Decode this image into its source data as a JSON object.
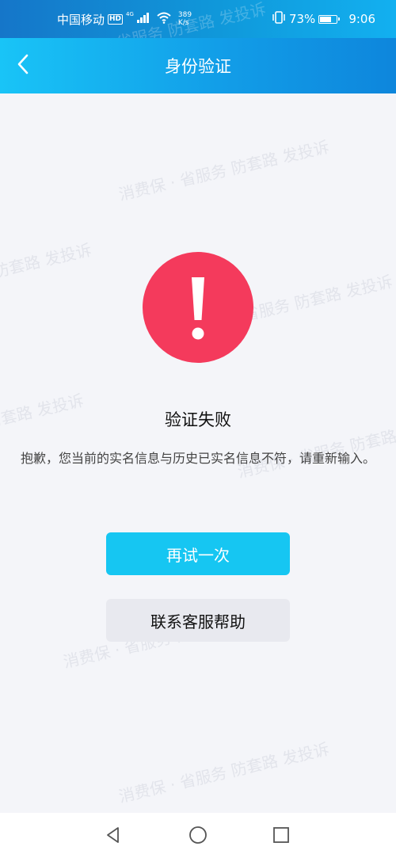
{
  "status_bar": {
    "carrier": "中国移动",
    "hd_badge": "HD",
    "network_type": "4G",
    "speed_value": "389",
    "speed_unit": "K/s",
    "battery_level": 0.73,
    "battery_percent": "73%",
    "time": "9:06"
  },
  "header": {
    "title": "身份验证",
    "back_icon": "chevron-left-icon"
  },
  "result": {
    "icon": "exclamation-icon",
    "icon_color": "#f43a5c",
    "title": "验证失败",
    "message": "抱歉，您当前的实名信息与历史已实名信息不符，请重新输入。"
  },
  "actions": {
    "retry_label": "再试一次",
    "support_label": "联系客服帮助",
    "retry_color": "#16c6f2"
  },
  "watermark": {
    "text": "消费保 · 省服务 防套路 发投诉"
  },
  "system_nav": {
    "back_icon": "triangle-back-icon",
    "home_icon": "circle-home-icon",
    "recents_icon": "square-recents-icon"
  }
}
